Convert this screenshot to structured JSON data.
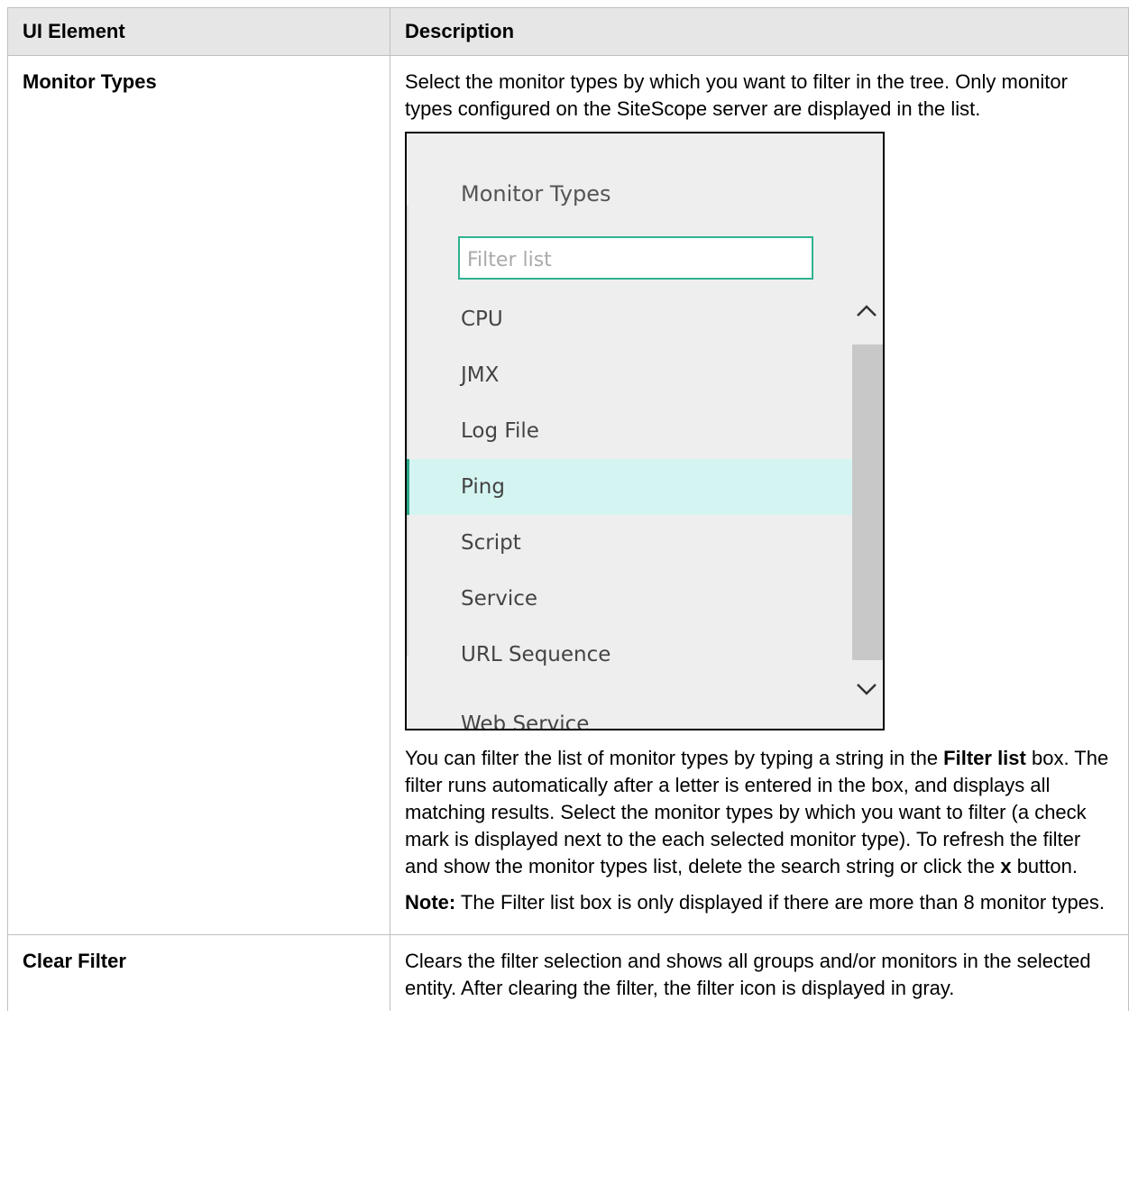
{
  "table": {
    "headers": [
      "UI Element",
      "Description"
    ],
    "rows": [
      {
        "element": "Monitor Types",
        "intro": "Select the monitor types by which you want to filter in the tree. Only monitor types configured on the SiteScope server are displayed in the list.",
        "panel": {
          "title": "Monitor Types",
          "filter_placeholder": "Filter list",
          "items": [
            "CPU",
            "JMX",
            "Log File",
            "Ping",
            "Script",
            "Service",
            "URL Sequence",
            "Web Service"
          ],
          "selected_item": "Ping"
        },
        "para1_a": "You can filter the list of monitor types by typing a string in the ",
        "para1_b": "Filter list",
        "para1_c": " box. The filter runs automatically after a letter is entered in the box, and displays all matching results. Select the monitor types by which you want to filter (a check mark is displayed next to the each selected monitor type). To refresh the filter and show the monitor types list, delete the search string or click the ",
        "para1_d": "x",
        "para1_e": " button.",
        "note_label": "Note:",
        "note_text": " The Filter list box is only displayed if there are more than 8 monitor types."
      },
      {
        "element": "Clear Filter",
        "description": "Clears the filter selection and shows all groups and/or monitors in the selected entity. After clearing the filter, the filter icon is displayed in gray."
      }
    ]
  },
  "colors": {
    "header_bg": "#e6e6e6",
    "accent": "#2fb291",
    "selected_bg": "#d4f4f2"
  }
}
